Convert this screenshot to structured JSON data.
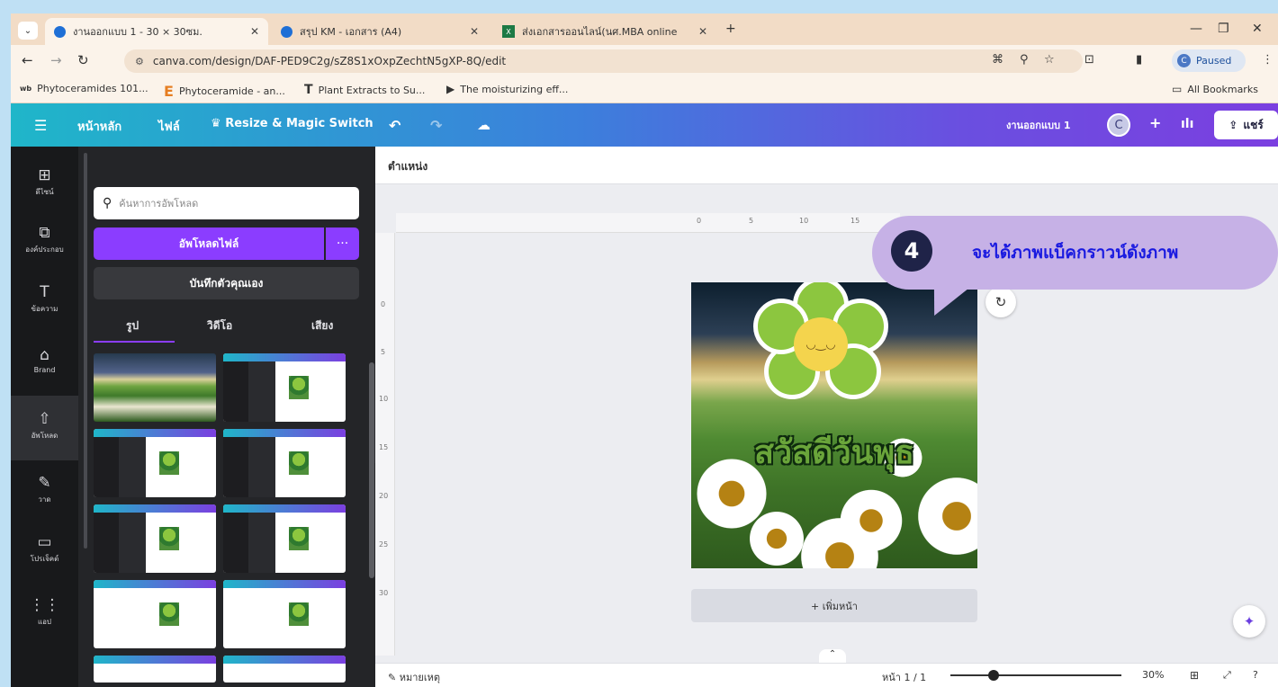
{
  "browser": {
    "tabs": [
      {
        "title": "งานออกแบบ 1 - 30 × 30ซม.",
        "active": true
      },
      {
        "title": "สรุป KM - เอกสาร (A4)",
        "active": false
      },
      {
        "title": "ส่งเอกสารออนไลน์(นศ.MBA online",
        "active": false
      }
    ],
    "new_tab": "+",
    "url": "canva.com/design/DAF-PED9C2g/sZ8S1xOxpZechtN5gXP-8Q/edit",
    "profile_status": "Paused",
    "profile_initial": "C",
    "bookmarks": [
      "Phytoceramides 101...",
      "Phytoceramide - an...",
      "Plant Extracts to Su...",
      "The moisturizing eff..."
    ],
    "all_bookmarks": "All Bookmarks"
  },
  "header": {
    "home": "หน้าหลัก",
    "file": "ไฟล์",
    "resize": "Resize & Magic Switch",
    "design_title": "งานออกแบบ 1",
    "user_initial": "C",
    "share": "แชร์"
  },
  "sidebar": {
    "items": [
      {
        "label": "ดีไซน์",
        "icon": "layout-icon"
      },
      {
        "label": "องค์ประกอบ",
        "icon": "elements-icon"
      },
      {
        "label": "ข้อความ",
        "icon": "text-icon"
      },
      {
        "label": "Brand",
        "icon": "brand-icon"
      },
      {
        "label": "อัพโหลด",
        "icon": "upload-icon"
      },
      {
        "label": "วาด",
        "icon": "draw-icon"
      },
      {
        "label": "โปรเจ็คต์",
        "icon": "folder-icon"
      },
      {
        "label": "แอป",
        "icon": "apps-icon"
      }
    ]
  },
  "panel": {
    "search_placeholder": "ค้นหาการอัพโหลด",
    "upload_button": "อัพโหลดไฟล์",
    "more": "···",
    "record_button": "บันทึกตัวคุณเอง",
    "tabs": [
      "รูป",
      "วิดีโอ",
      "เสียง"
    ]
  },
  "toolbar": {
    "position": "ตำแหน่ง"
  },
  "ruler": {
    "h": [
      "0",
      "5",
      "10",
      "15"
    ],
    "v": [
      "0",
      "5",
      "10",
      "15",
      "20",
      "25",
      "30"
    ]
  },
  "design": {
    "greeting": "สวัสดีวันพุธ"
  },
  "add_page": "+ เพิ่มหน้า",
  "callout": {
    "number": "4",
    "text": "จะได้ภาพแบ็คกราวน์ดังภาพ"
  },
  "bottom": {
    "notes": "หมายเหตุ",
    "page": "หน้า 1 / 1",
    "zoom": "30%",
    "zoom_level": 0.3
  }
}
